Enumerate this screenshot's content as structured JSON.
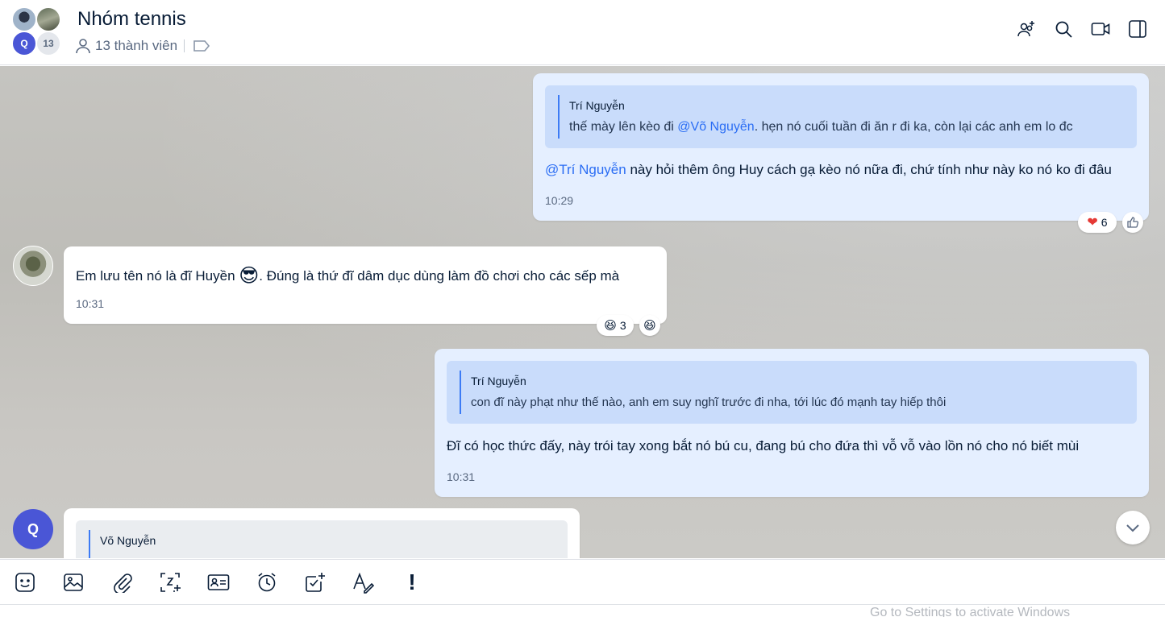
{
  "header": {
    "title": "Nhóm tennis",
    "member_count_badge": "13",
    "avatar_initial": "Q",
    "members_label": "13 thành viên",
    "icons": [
      "add-member-icon",
      "search-icon",
      "video-call-icon",
      "toggle-sidebar-icon"
    ]
  },
  "messages": [
    {
      "side": "mine",
      "quote_author": "Trí Nguyễn",
      "quote_text_before": "thế mày lên kèo đi ",
      "quote_mention": "@Võ Nguyễn",
      "quote_text_after": ". hẹn nó cuối tuần đi ăn r đi ka, còn lại các anh em lo đc",
      "mention": "@Trí Nguyễn",
      "text": " này hỏi thêm ông Huy cách gạ kèo nó nữa đi, chứ tính như này ko nó ko đi đâu",
      "time": "10:29",
      "reaction_count": "6"
    },
    {
      "side": "theirs",
      "text_before": "Em lưu tên nó là đĩ Huyền ",
      "emoji": "😎",
      "text_after": ". Đúng là thứ đĩ dâm dục dùng làm đồ chơi cho các sếp mà",
      "time": "10:31",
      "reaction_count": "3"
    },
    {
      "side": "mine",
      "quote_author": "Trí Nguyễn",
      "quote_text": "con đĩ này phạt như thế nào, anh em suy nghĩ trước đi nha, tới lúc đó mạnh tay hiếp thôi",
      "text": "Đĩ có học thức đấy, này trói tay xong bắt nó bú cu, đang bú cho đứa thì vỗ vỗ vào lồn nó cho nó biết mùi",
      "time": "10:31"
    },
    {
      "side": "theirs",
      "avatar_initial": "Q",
      "quote_author": "Võ Nguyễn"
    }
  ],
  "toolbar": {
    "items": [
      "sticker-icon",
      "image-icon",
      "attach-icon",
      "screenshot-icon",
      "contact-card-icon",
      "reminder-icon",
      "task-icon",
      "text-format-icon",
      "important-icon"
    ]
  },
  "watermark": "Go to Settings to activate Windows"
}
